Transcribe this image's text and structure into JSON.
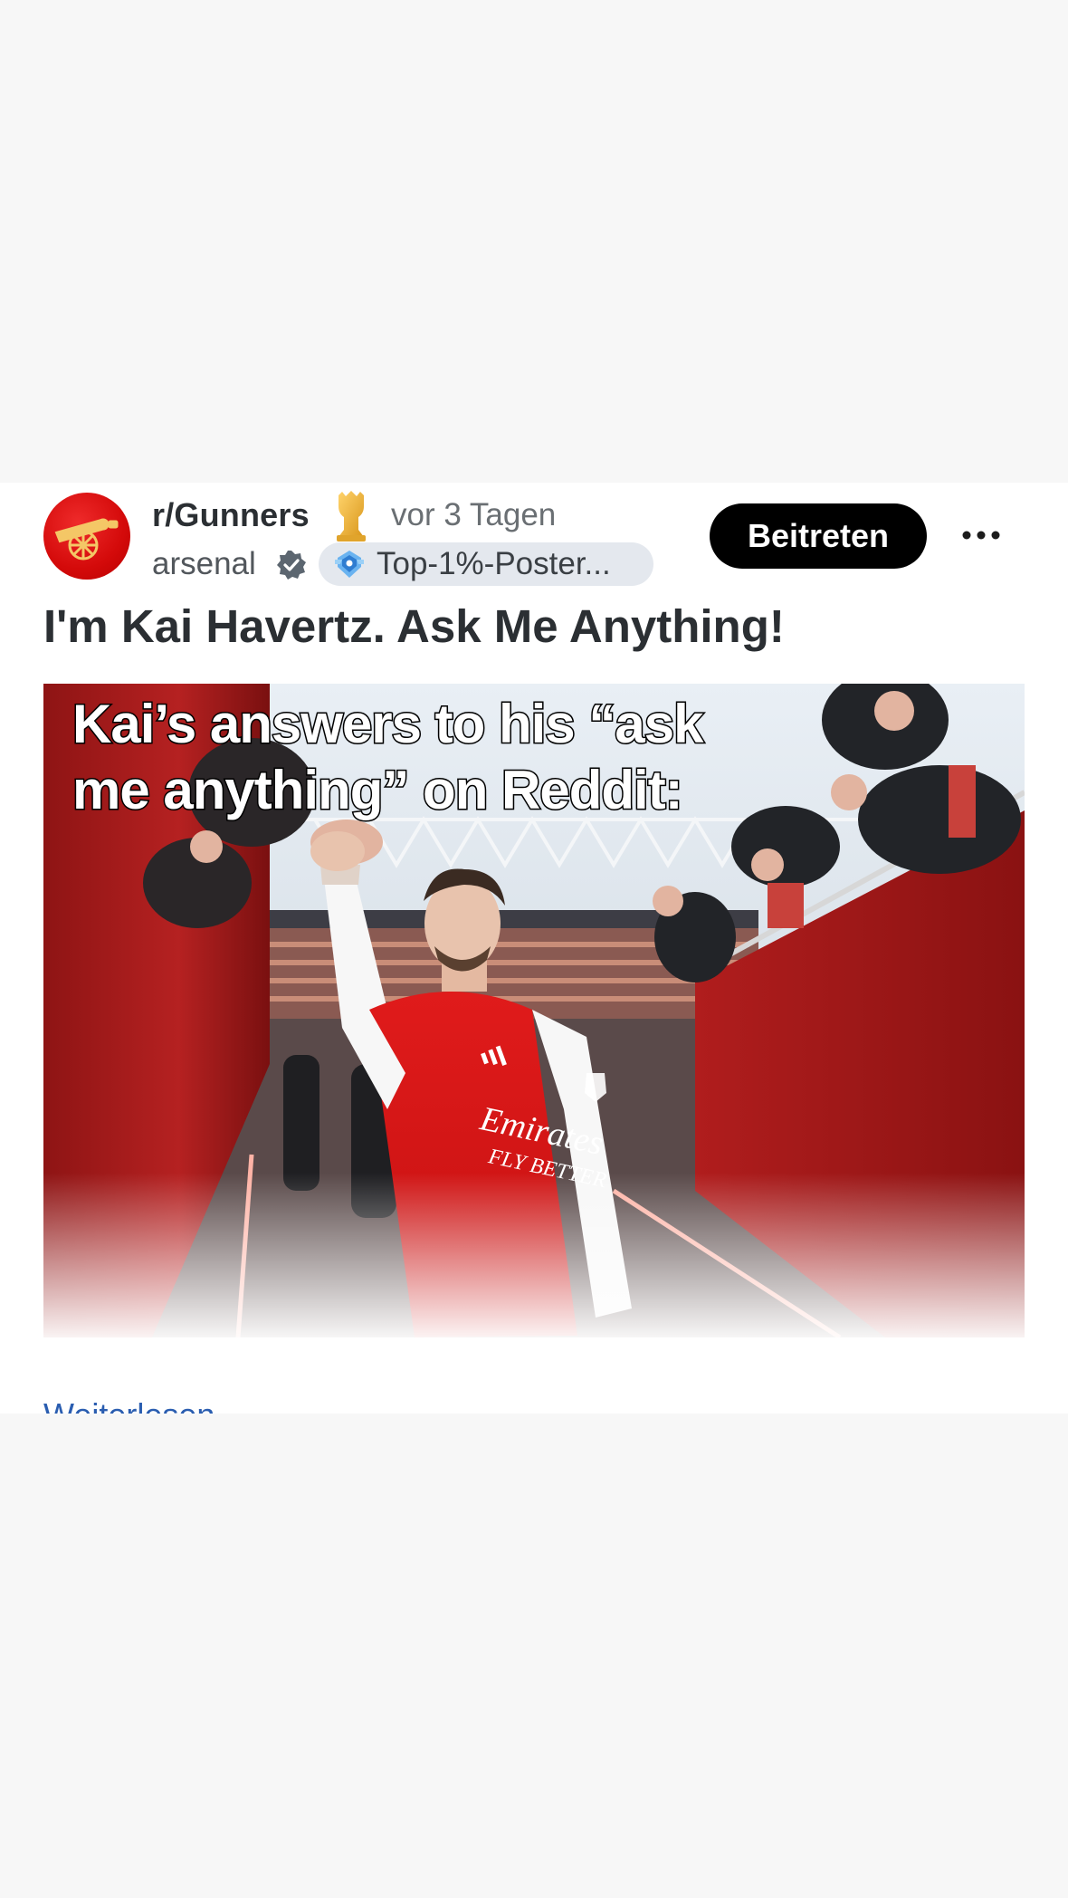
{
  "post": {
    "subreddit": "r/Gunners",
    "time": "vor 3 Tagen",
    "username": "arsenal",
    "flair": "Top-1%-Poster...",
    "join_label": "Beitreten",
    "title": "I'm Kai Havertz. Ask Me Anything!",
    "image_caption": "Kai’s answers to his “ask me anything” on Reddit:",
    "read_more": "Weiterlesen"
  },
  "icons": {
    "avatar": "arsenal-cannon-logo",
    "badge": "trophy-icon",
    "verified": "verified-check-icon",
    "flair": "top-poster-badge-icon",
    "more": "more-options-icon"
  },
  "colors": {
    "brand_red": "#db0007",
    "button": "#000000",
    "link": "#2a5db0"
  }
}
